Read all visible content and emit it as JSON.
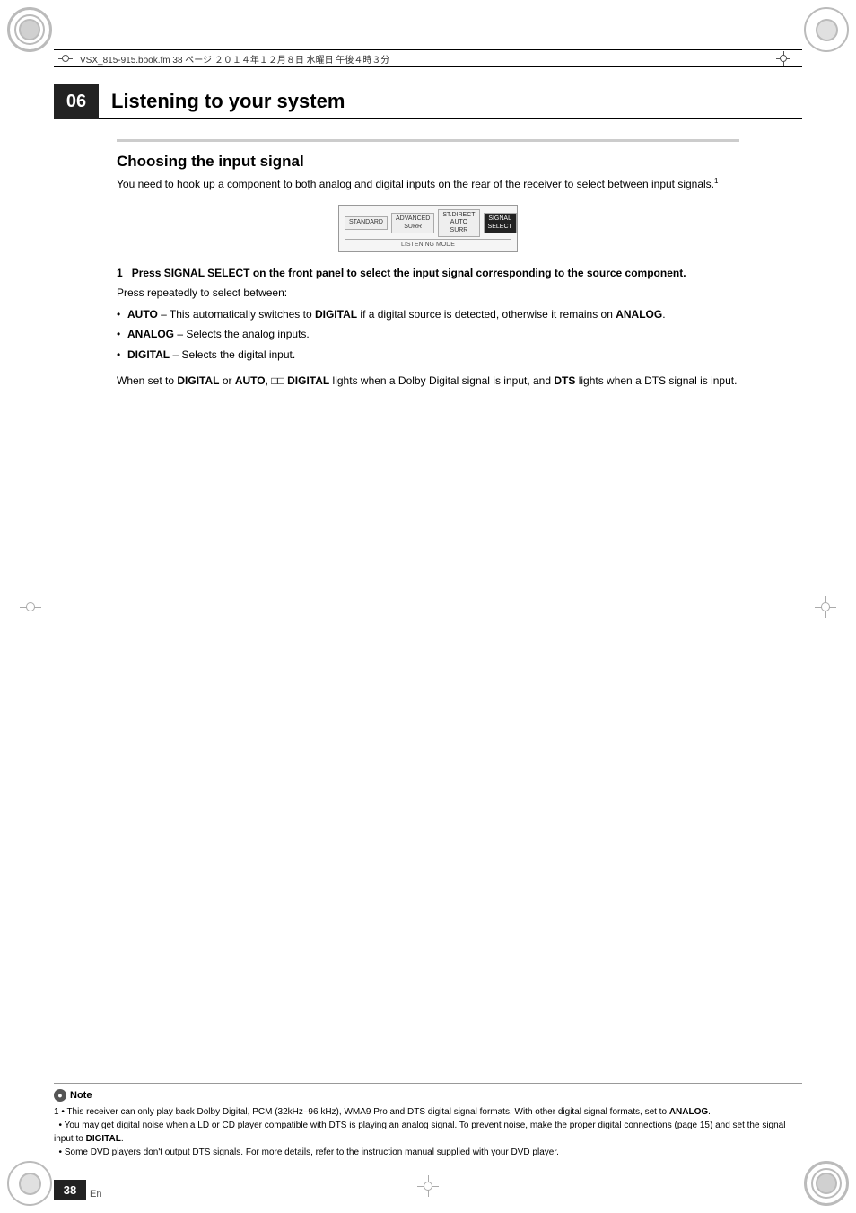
{
  "page": {
    "number": "38",
    "lang": "En"
  },
  "file_info": {
    "text": "VSX_815-915.book.fm  38 ページ  ２０１４年１２月８日  水曜日  午後４時３分"
  },
  "chapter": {
    "number": "06",
    "title": "Listening to your system"
  },
  "section": {
    "title": "Choosing the input signal",
    "intro": "You need to hook up a component to both analog and digital inputs on the rear of the receiver to select between input signals.",
    "intro_footnote": "1"
  },
  "signal_image": {
    "tabs": [
      {
        "label": "STANDARD",
        "active": false
      },
      {
        "label": "ADVANCED\nSURR",
        "active": false
      },
      {
        "label": "ST.DIRECT\nAUTO SURR",
        "active": false
      },
      {
        "label": "SIGNAL\nSELECT",
        "active": true
      }
    ],
    "bottom_label": "LISTENING MODE"
  },
  "step1": {
    "header": "1   Press SIGNAL SELECT on the front panel to select the input signal corresponding to the source component.",
    "sub_intro": "Press repeatedly to select between:",
    "bullets": [
      {
        "term": "AUTO",
        "separator": " – ",
        "text": "This automatically switches to ",
        "bold_word": "DIGITAL",
        "rest": " if a digital source is detected, otherwise it remains on ",
        "bold_word2": "ANALOG",
        "end": "."
      },
      {
        "term": "ANALOG",
        "separator": " – ",
        "text": "Selects the analog inputs."
      },
      {
        "term": "DIGITAL",
        "separator": " – ",
        "text": "Selects the digital input."
      }
    ],
    "digital_note": "When set to ",
    "digital_bold1": "DIGITAL",
    "digital_or": " or ",
    "digital_bold2": "AUTO",
    "digital_dd": ", ⊡⊡ DIGITAL",
    "digital_rest": " lights when a Dolby Digital signal is input, and ",
    "digital_dts": "DTS",
    "digital_end": " lights when a DTS signal is input."
  },
  "note": {
    "label": "Note",
    "items": [
      "1 • This receiver can only play back Dolby Digital, PCM (32kHz–96 kHz), WMA9 Pro and DTS digital signal formats. With other digital signal formats, set to ANALOG.",
      "  • You may get digital noise when a LD or CD player compatible with DTS is playing an analog signal. To prevent noise, make the proper digital connections (page 15) and set the signal input to DIGITAL.",
      "  • Some DVD players don't output DTS signals. For more details, refer to the instruction manual supplied with your DVD player."
    ]
  }
}
